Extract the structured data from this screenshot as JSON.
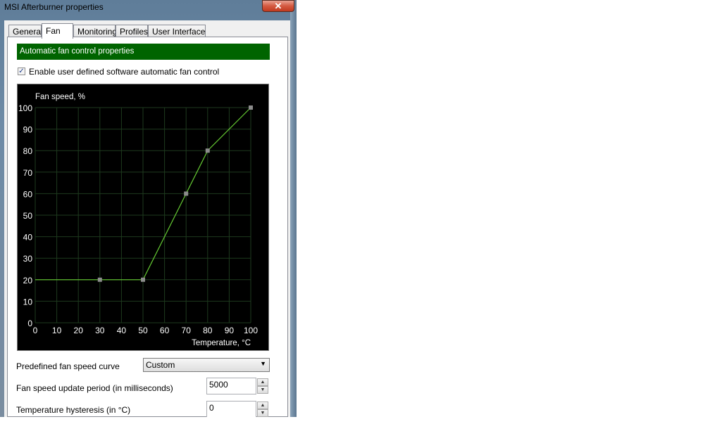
{
  "window": {
    "title": "MSI Afterburner properties",
    "close_glyph": "✕"
  },
  "tabs": [
    {
      "label": "General"
    },
    {
      "label": "Fan",
      "active": true
    },
    {
      "label": "Monitoring"
    },
    {
      "label": "Profiles"
    },
    {
      "label": "User Interface"
    }
  ],
  "fan": {
    "section_header": "Automatic fan control properties",
    "enable_checkbox": {
      "label": "Enable user defined software automatic fan control",
      "checked": true,
      "glyph": "✓"
    },
    "predefined_curve": {
      "label": "Predefined fan speed curve",
      "value": "Custom",
      "arrow": "▼"
    },
    "update_period": {
      "label": "Fan speed update period (in milliseconds)",
      "value": "5000"
    },
    "hysteresis": {
      "label": "Temperature hysteresis (in °C)",
      "value": "0"
    },
    "spin_up_glyph": "▲",
    "spin_down_glyph": "▼"
  },
  "colors": {
    "header_bg": "#006400",
    "curve": "#66cc33",
    "grid": "#1e3a1e",
    "plot_bg": "#000000"
  },
  "chart_data": {
    "type": "line",
    "ylabel": "Fan speed, %",
    "xlabel": "Temperature, °C",
    "xlim": [
      0,
      100
    ],
    "ylim": [
      0,
      100
    ],
    "x_ticks": [
      0,
      10,
      20,
      30,
      40,
      50,
      60,
      70,
      80,
      90,
      100
    ],
    "y_ticks": [
      0,
      10,
      20,
      30,
      40,
      50,
      60,
      70,
      80,
      90,
      100
    ],
    "grid": true,
    "curve_start": [
      0,
      20
    ],
    "points": [
      {
        "x": 30,
        "y": 20
      },
      {
        "x": 50,
        "y": 20
      },
      {
        "x": 70,
        "y": 60
      },
      {
        "x": 80,
        "y": 80
      },
      {
        "x": 100,
        "y": 100
      }
    ]
  }
}
